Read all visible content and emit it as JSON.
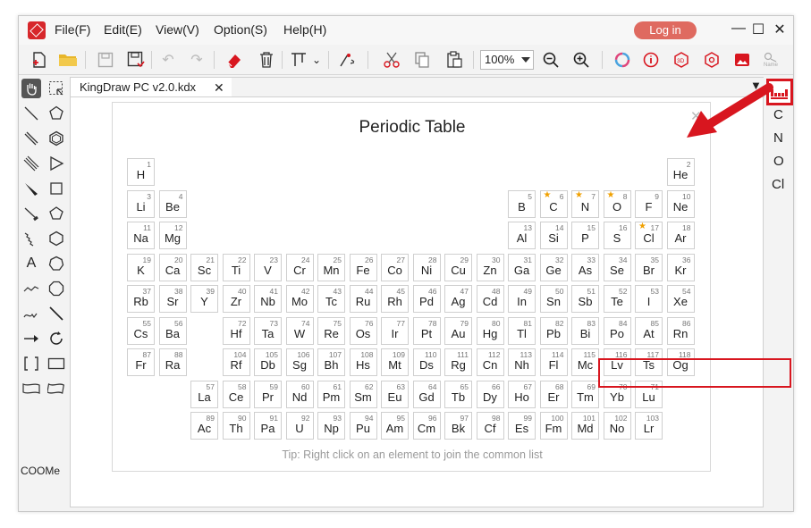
{
  "menu": {
    "file": "File(F)",
    "edit": "Edit(E)",
    "view": "View(V)",
    "option": "Option(S)",
    "help": "Help(H)"
  },
  "login_label": "Log in",
  "zoom": "100%",
  "name_label": "Name",
  "tab_title": "KingDraw PC v2.0.kdx",
  "left_tools_text": {
    "atom_a": "A",
    "coome": "COOMe"
  },
  "right_panel_atoms": [
    "C",
    "N",
    "O",
    "Cl"
  ],
  "dialog": {
    "title": "Periodic Table",
    "tip": "Tip: Right click on an element to join the common list"
  },
  "elements": [
    {
      "n": "1",
      "s": "H",
      "r": 0,
      "c": 0
    },
    {
      "n": "2",
      "s": "He",
      "r": 0,
      "c": 17
    },
    {
      "n": "3",
      "s": "Li",
      "r": 1,
      "c": 0
    },
    {
      "n": "4",
      "s": "Be",
      "r": 1,
      "c": 1
    },
    {
      "n": "5",
      "s": "B",
      "r": 1,
      "c": 12
    },
    {
      "n": "6",
      "s": "C",
      "r": 1,
      "c": 13,
      "star": true
    },
    {
      "n": "7",
      "s": "N",
      "r": 1,
      "c": 14,
      "star": true
    },
    {
      "n": "8",
      "s": "O",
      "r": 1,
      "c": 15,
      "star": true
    },
    {
      "n": "9",
      "s": "F",
      "r": 1,
      "c": 16
    },
    {
      "n": "10",
      "s": "Ne",
      "r": 1,
      "c": 17
    },
    {
      "n": "11",
      "s": "Na",
      "r": 2,
      "c": 0
    },
    {
      "n": "12",
      "s": "Mg",
      "r": 2,
      "c": 1
    },
    {
      "n": "13",
      "s": "Al",
      "r": 2,
      "c": 12
    },
    {
      "n": "14",
      "s": "Si",
      "r": 2,
      "c": 13
    },
    {
      "n": "15",
      "s": "P",
      "r": 2,
      "c": 14
    },
    {
      "n": "16",
      "s": "S",
      "r": 2,
      "c": 15
    },
    {
      "n": "17",
      "s": "Cl",
      "r": 2,
      "c": 16,
      "star": true
    },
    {
      "n": "18",
      "s": "Ar",
      "r": 2,
      "c": 17
    },
    {
      "n": "19",
      "s": "K",
      "r": 3,
      "c": 0
    },
    {
      "n": "20",
      "s": "Ca",
      "r": 3,
      "c": 1
    },
    {
      "n": "21",
      "s": "Sc",
      "r": 3,
      "c": 2
    },
    {
      "n": "22",
      "s": "Ti",
      "r": 3,
      "c": 3
    },
    {
      "n": "23",
      "s": "V",
      "r": 3,
      "c": 4
    },
    {
      "n": "24",
      "s": "Cr",
      "r": 3,
      "c": 5
    },
    {
      "n": "25",
      "s": "Mn",
      "r": 3,
      "c": 6
    },
    {
      "n": "26",
      "s": "Fe",
      "r": 3,
      "c": 7
    },
    {
      "n": "27",
      "s": "Co",
      "r": 3,
      "c": 8
    },
    {
      "n": "28",
      "s": "Ni",
      "r": 3,
      "c": 9
    },
    {
      "n": "29",
      "s": "Cu",
      "r": 3,
      "c": 10
    },
    {
      "n": "30",
      "s": "Zn",
      "r": 3,
      "c": 11
    },
    {
      "n": "31",
      "s": "Ga",
      "r": 3,
      "c": 12
    },
    {
      "n": "32",
      "s": "Ge",
      "r": 3,
      "c": 13
    },
    {
      "n": "33",
      "s": "As",
      "r": 3,
      "c": 14
    },
    {
      "n": "34",
      "s": "Se",
      "r": 3,
      "c": 15
    },
    {
      "n": "35",
      "s": "Br",
      "r": 3,
      "c": 16
    },
    {
      "n": "36",
      "s": "Kr",
      "r": 3,
      "c": 17
    },
    {
      "n": "37",
      "s": "Rb",
      "r": 4,
      "c": 0
    },
    {
      "n": "38",
      "s": "Sr",
      "r": 4,
      "c": 1
    },
    {
      "n": "39",
      "s": "Y",
      "r": 4,
      "c": 2
    },
    {
      "n": "40",
      "s": "Zr",
      "r": 4,
      "c": 3
    },
    {
      "n": "41",
      "s": "Nb",
      "r": 4,
      "c": 4
    },
    {
      "n": "42",
      "s": "Mo",
      "r": 4,
      "c": 5
    },
    {
      "n": "43",
      "s": "Tc",
      "r": 4,
      "c": 6
    },
    {
      "n": "44",
      "s": "Ru",
      "r": 4,
      "c": 7
    },
    {
      "n": "45",
      "s": "Rh",
      "r": 4,
      "c": 8
    },
    {
      "n": "46",
      "s": "Pd",
      "r": 4,
      "c": 9
    },
    {
      "n": "47",
      "s": "Ag",
      "r": 4,
      "c": 10
    },
    {
      "n": "48",
      "s": "Cd",
      "r": 4,
      "c": 11
    },
    {
      "n": "49",
      "s": "In",
      "r": 4,
      "c": 12
    },
    {
      "n": "50",
      "s": "Sn",
      "r": 4,
      "c": 13
    },
    {
      "n": "51",
      "s": "Sb",
      "r": 4,
      "c": 14
    },
    {
      "n": "52",
      "s": "Te",
      "r": 4,
      "c": 15
    },
    {
      "n": "53",
      "s": "I",
      "r": 4,
      "c": 16
    },
    {
      "n": "54",
      "s": "Xe",
      "r": 4,
      "c": 17
    },
    {
      "n": "55",
      "s": "Cs",
      "r": 5,
      "c": 0
    },
    {
      "n": "56",
      "s": "Ba",
      "r": 5,
      "c": 1
    },
    {
      "n": "72",
      "s": "Hf",
      "r": 5,
      "c": 3
    },
    {
      "n": "73",
      "s": "Ta",
      "r": 5,
      "c": 4
    },
    {
      "n": "74",
      "s": "W",
      "r": 5,
      "c": 5
    },
    {
      "n": "75",
      "s": "Re",
      "r": 5,
      "c": 6
    },
    {
      "n": "76",
      "s": "Os",
      "r": 5,
      "c": 7
    },
    {
      "n": "77",
      "s": "Ir",
      "r": 5,
      "c": 8
    },
    {
      "n": "78",
      "s": "Pt",
      "r": 5,
      "c": 9
    },
    {
      "n": "79",
      "s": "Au",
      "r": 5,
      "c": 10
    },
    {
      "n": "80",
      "s": "Hg",
      "r": 5,
      "c": 11
    },
    {
      "n": "81",
      "s": "Tl",
      "r": 5,
      "c": 12
    },
    {
      "n": "82",
      "s": "Pb",
      "r": 5,
      "c": 13
    },
    {
      "n": "83",
      "s": "Bi",
      "r": 5,
      "c": 14
    },
    {
      "n": "84",
      "s": "Po",
      "r": 5,
      "c": 15
    },
    {
      "n": "85",
      "s": "At",
      "r": 5,
      "c": 16
    },
    {
      "n": "86",
      "s": "Rn",
      "r": 5,
      "c": 17
    },
    {
      "n": "87",
      "s": "Fr",
      "r": 6,
      "c": 0
    },
    {
      "n": "88",
      "s": "Ra",
      "r": 6,
      "c": 1
    },
    {
      "n": "104",
      "s": "Rf",
      "r": 6,
      "c": 3
    },
    {
      "n": "105",
      "s": "Db",
      "r": 6,
      "c": 4
    },
    {
      "n": "106",
      "s": "Sg",
      "r": 6,
      "c": 5
    },
    {
      "n": "107",
      "s": "Bh",
      "r": 6,
      "c": 6
    },
    {
      "n": "108",
      "s": "Hs",
      "r": 6,
      "c": 7
    },
    {
      "n": "109",
      "s": "Mt",
      "r": 6,
      "c": 8
    },
    {
      "n": "110",
      "s": "Ds",
      "r": 6,
      "c": 9
    },
    {
      "n": "111",
      "s": "Rg",
      "r": 6,
      "c": 10
    },
    {
      "n": "112",
      "s": "Cn",
      "r": 6,
      "c": 11
    },
    {
      "n": "113",
      "s": "Nh",
      "r": 6,
      "c": 12
    },
    {
      "n": "114",
      "s": "Fl",
      "r": 6,
      "c": 13
    },
    {
      "n": "115",
      "s": "Mc",
      "r": 6,
      "c": 14
    },
    {
      "n": "116",
      "s": "Lv",
      "r": 6,
      "c": 15
    },
    {
      "n": "117",
      "s": "Ts",
      "r": 6,
      "c": 16
    },
    {
      "n": "118",
      "s": "Og",
      "r": 6,
      "c": 17
    },
    {
      "n": "57",
      "s": "La",
      "r": 7,
      "c": 2
    },
    {
      "n": "58",
      "s": "Ce",
      "r": 7,
      "c": 3
    },
    {
      "n": "59",
      "s": "Pr",
      "r": 7,
      "c": 4
    },
    {
      "n": "60",
      "s": "Nd",
      "r": 7,
      "c": 5
    },
    {
      "n": "61",
      "s": "Pm",
      "r": 7,
      "c": 6
    },
    {
      "n": "62",
      "s": "Sm",
      "r": 7,
      "c": 7
    },
    {
      "n": "63",
      "s": "Eu",
      "r": 7,
      "c": 8
    },
    {
      "n": "64",
      "s": "Gd",
      "r": 7,
      "c": 9
    },
    {
      "n": "65",
      "s": "Tb",
      "r": 7,
      "c": 10
    },
    {
      "n": "66",
      "s": "Dy",
      "r": 7,
      "c": 11
    },
    {
      "n": "67",
      "s": "Ho",
      "r": 7,
      "c": 12
    },
    {
      "n": "68",
      "s": "Er",
      "r": 7,
      "c": 13
    },
    {
      "n": "69",
      "s": "Tm",
      "r": 7,
      "c": 14
    },
    {
      "n": "70",
      "s": "Yb",
      "r": 7,
      "c": 15
    },
    {
      "n": "71",
      "s": "Lu",
      "r": 7,
      "c": 16
    },
    {
      "n": "89",
      "s": "Ac",
      "r": 8,
      "c": 2
    },
    {
      "n": "90",
      "s": "Th",
      "r": 8,
      "c": 3
    },
    {
      "n": "91",
      "s": "Pa",
      "r": 8,
      "c": 4
    },
    {
      "n": "92",
      "s": "U",
      "r": 8,
      "c": 5
    },
    {
      "n": "93",
      "s": "Np",
      "r": 8,
      "c": 6
    },
    {
      "n": "94",
      "s": "Pu",
      "r": 8,
      "c": 7
    },
    {
      "n": "95",
      "s": "Am",
      "r": 8,
      "c": 8
    },
    {
      "n": "96",
      "s": "Cm",
      "r": 8,
      "c": 9
    },
    {
      "n": "97",
      "s": "Bk",
      "r": 8,
      "c": 10
    },
    {
      "n": "98",
      "s": "Cf",
      "r": 8,
      "c": 11
    },
    {
      "n": "99",
      "s": "Es",
      "r": 8,
      "c": 12
    },
    {
      "n": "100",
      "s": "Fm",
      "r": 8,
      "c": 13
    },
    {
      "n": "101",
      "s": "Md",
      "r": 8,
      "c": 14
    },
    {
      "n": "102",
      "s": "No",
      "r": 8,
      "c": 15
    },
    {
      "n": "103",
      "s": "Lr",
      "r": 8,
      "c": 16
    }
  ],
  "colors": {
    "accent": "#d8161f",
    "login": "#df6a60",
    "star": "#f0a000"
  }
}
